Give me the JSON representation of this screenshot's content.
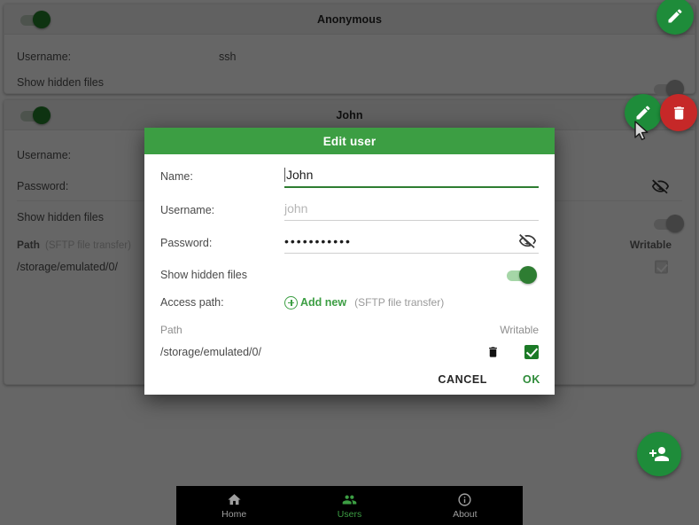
{
  "background": {
    "cards": [
      {
        "title": "Anonymous",
        "enabled_toggle": "on",
        "rows": [
          {
            "label": "Username:",
            "value": "ssh"
          },
          {
            "label": "Show hidden files",
            "value": "",
            "toggle": "off"
          }
        ],
        "actions": [
          {
            "icon": "pencil-icon",
            "color": "#1e8c3a"
          }
        ]
      },
      {
        "title": "John",
        "enabled_toggle": "on",
        "rows": [
          {
            "label": "Username:",
            "value": ""
          },
          {
            "label": "Password:",
            "value": "",
            "icon": "eye-off-icon"
          },
          {
            "label": "Show hidden files",
            "value": "",
            "toggle": "off"
          }
        ],
        "path_header": "Path",
        "path_header_sub": "(SFTP file transfer)",
        "writable_header": "Writable",
        "path_value": "/storage/emulated/0/",
        "actions": [
          {
            "icon": "pencil-icon",
            "color": "#1e8c3a"
          },
          {
            "icon": "trash-icon",
            "color": "#c62828"
          }
        ]
      }
    ],
    "fab_add_user": "person-add-icon"
  },
  "dialog": {
    "title": "Edit user",
    "title_bar_color": "#3c9e43",
    "fields": [
      {
        "label": "Name:",
        "value": "John",
        "placeholder": "",
        "focused": true
      },
      {
        "label": "Username:",
        "value": "",
        "placeholder": "john",
        "focused": false
      },
      {
        "label": "Password:",
        "value": "•••••••••••",
        "placeholder": "",
        "focused": false,
        "icon": "eye-off-icon"
      }
    ],
    "show_hidden_files": {
      "label": "Show hidden files",
      "state": "on"
    },
    "access_path": {
      "label": "Access path:",
      "add_new_label": "Add new",
      "add_new_note": "(SFTP file transfer)"
    },
    "table": {
      "columns": [
        "Path",
        "Writable"
      ],
      "rows": [
        {
          "path": "/storage/emulated/0/",
          "delete_icon": "trash-icon",
          "writable": true
        }
      ]
    },
    "buttons": {
      "cancel": "CANCEL",
      "ok": "OK"
    }
  },
  "bottom_nav": {
    "items": [
      {
        "label": "Home",
        "icon": "home-icon",
        "active": false
      },
      {
        "label": "Users",
        "icon": "users-icon",
        "active": true
      },
      {
        "label": "About",
        "icon": "info-icon",
        "active": false
      }
    ],
    "active_color": "#3c9e43",
    "inactive_color": "#9e9e9e"
  }
}
